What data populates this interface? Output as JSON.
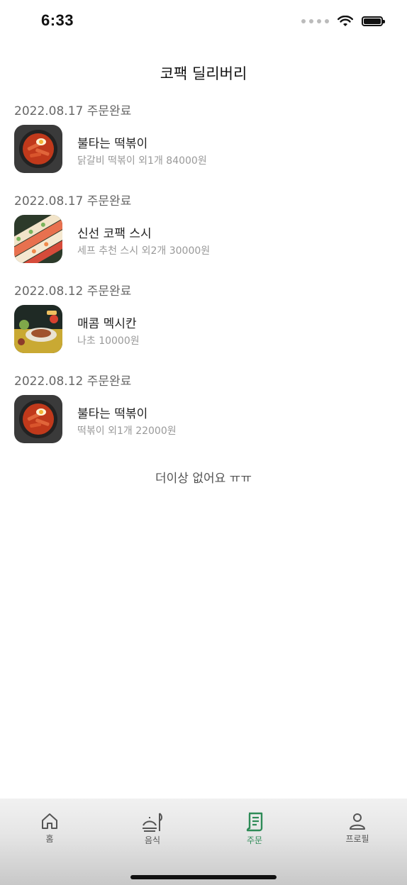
{
  "status_bar": {
    "time": "6:33"
  },
  "header": {
    "title": "코팩 딜리버리"
  },
  "orders": [
    {
      "date_status": "2022.08.17 주문완료",
      "name": "불타는 떡볶이",
      "summary": "닭갈비 떡볶이 외1개 84000원",
      "thumbnail": "tteokbokki-image"
    },
    {
      "date_status": "2022.08.17 주문완료",
      "name": "신선 코팩 스시",
      "summary": "세프 추천 스시 외2개 30000원",
      "thumbnail": "sushi-image"
    },
    {
      "date_status": "2022.08.12 주문완료",
      "name": "매콤 멕시칸",
      "summary": "나초 10000원",
      "thumbnail": "mexican-food-image"
    },
    {
      "date_status": "2022.08.12 주문완료",
      "name": "불타는 떡볶이",
      "summary": "떡볶이 외1개 22000원",
      "thumbnail": "tteokbokki-image"
    }
  ],
  "footer_message": "더이상 없어요 ㅠㅠ",
  "tab_bar": {
    "items": [
      {
        "label": "홈",
        "icon": "home-icon"
      },
      {
        "label": "음식",
        "icon": "food-icon"
      },
      {
        "label": "주문",
        "icon": "order-receipt-icon",
        "active": true
      },
      {
        "label": "프로필",
        "icon": "profile-icon"
      }
    ],
    "active_color": "#2e8b57"
  }
}
